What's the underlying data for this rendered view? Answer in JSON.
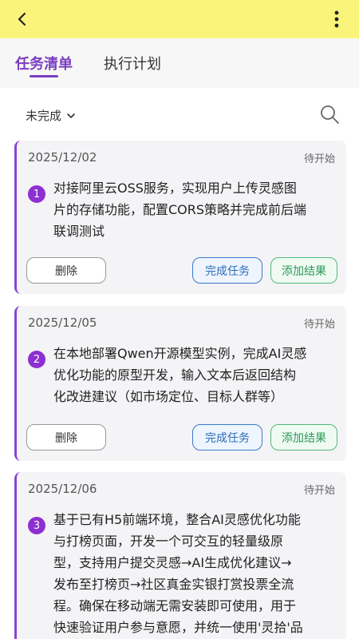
{
  "header": {
    "back_icon": "chevron-left-icon",
    "more_icon": "more-vertical-icon"
  },
  "tabs": [
    {
      "label": "任务清单",
      "active": true
    },
    {
      "label": "执行计划",
      "active": false
    }
  ],
  "filter": {
    "selected": "未完成",
    "search_icon": "search-icon"
  },
  "tasks": [
    {
      "date": "2025/12/02",
      "status": "待开始",
      "number": "1",
      "lines": [
        "对接阿里云OSS服务，实现用户上传灵感图",
        "片的存储功能，配置CORS策略并完成前后端",
        "联调测试"
      ],
      "delete_label": "删除",
      "complete_label": "完成任务",
      "result_label": "添加结果"
    },
    {
      "date": "2025/12/05",
      "status": "待开始",
      "number": "2",
      "lines": [
        "在本地部署Qwen开源模型实例，完成AI灵感",
        "优化功能的原型开发，输入文本后返回结构",
        "化改进建议（如市场定位、目标人群等）"
      ],
      "delete_label": "删除",
      "complete_label": "完成任务",
      "result_label": "添加结果"
    },
    {
      "date": "2025/12/06",
      "status": "待开始",
      "number": "3",
      "lines": [
        "基于已有H5前端环境，整合AI灵感优化功能",
        "与打榜页面，开发一个可交互的轻量级原",
        "型，支持用户提交灵感→AI生成优化建议→",
        "发布至打榜页→社区真金实银打赏投票全流",
        "程。确保在移动端无需安装即可使用，用于",
        "快速验证用户参与意愿，并统一使用'灵拾'品"
      ]
    }
  ]
}
